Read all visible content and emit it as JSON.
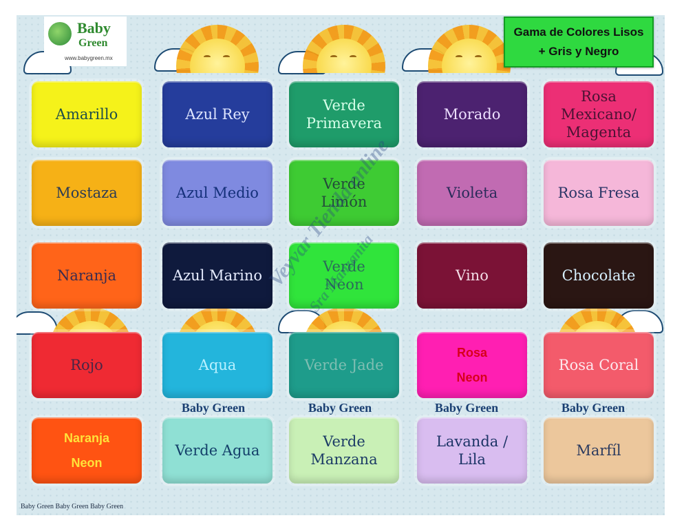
{
  "logo": {
    "word1": "Baby",
    "word2": "Green",
    "url": "www.babygreen.mx",
    "icon": "baby-green-logo-icon"
  },
  "title": {
    "line1": "Gama de Colores Lisos",
    "line2": "+ Gris y Negro"
  },
  "swatches": [
    {
      "lines": [
        "Amarillo"
      ],
      "bg": "#f5f21a",
      "fg": "#1e4d4a"
    },
    {
      "lines": [
        "Azul Rey"
      ],
      "bg": "#253d9c",
      "fg": "#dfe6ff"
    },
    {
      "lines": [
        "Verde",
        "Primavera"
      ],
      "bg": "#1f9c6a",
      "fg": "#d6ffe9"
    },
    {
      "lines": [
        "Morado"
      ],
      "bg": "#4c2270",
      "fg": "#ece0ff"
    },
    {
      "lines": [
        "Rosa",
        "Mexicano/",
        "Magenta"
      ],
      "bg": "#ec2f75",
      "fg": "#4a1233"
    },
    {
      "lines": [
        "Mostaza"
      ],
      "bg": "#f6b116",
      "fg": "#2b3b55"
    },
    {
      "lines": [
        "Azul Medio"
      ],
      "bg": "#7f8ae0",
      "fg": "#14307a"
    },
    {
      "lines": [
        "Verde",
        "Limón"
      ],
      "bg": "#3ecb33",
      "fg": "#234a3a"
    },
    {
      "lines": [
        "Violeta"
      ],
      "bg": "#c16bb2",
      "fg": "#2b2b5a"
    },
    {
      "lines": [
        "Rosa Fresa"
      ],
      "bg": "#f5b7d9",
      "fg": "#2b3566"
    },
    {
      "lines": [
        "Naranja"
      ],
      "bg": "#ff6419",
      "fg": "#3a2c4f"
    },
    {
      "lines": [
        "Azul Marino"
      ],
      "bg": "#0f1a3d",
      "fg": "#e6ecff"
    },
    {
      "lines": [
        "Verde",
        "Neon"
      ],
      "bg": "#30e43b",
      "fg": "#2b6a5a"
    },
    {
      "lines": [
        "Vino"
      ],
      "bg": "#7b1236",
      "fg": "#f3dce6"
    },
    {
      "lines": [
        "Chocolate"
      ],
      "bg": "#2a1613",
      "fg": "#d7f0ff"
    },
    {
      "lines": [
        "Rojo"
      ],
      "bg": "#ef2a33",
      "fg": "#4a2545"
    },
    {
      "lines": [
        "Aqua"
      ],
      "bg": "#23b5dc",
      "fg": "#b9f1ff"
    },
    {
      "lines": [
        "Verde Jade"
      ],
      "bg": "#1e9c8b",
      "fg": "#7fbeb2"
    },
    {
      "lines": [
        "Rosa",
        "Neon"
      ],
      "bg": "#ff1fb2",
      "fg": "#d7001c",
      "sans": true
    },
    {
      "lines": [
        "Rosa Coral"
      ],
      "bg": "#f35b6b",
      "fg": "#fde8ee"
    },
    {
      "lines": [
        "Naranja",
        "Neon"
      ],
      "bg": "#ff5312",
      "fg": "#ffe23a",
      "sans": true
    },
    {
      "lines": [
        "Verde Agua"
      ],
      "bg": "#8fe0d4",
      "fg": "#14406a"
    },
    {
      "lines": [
        "Verde",
        "Manzana"
      ],
      "bg": "#c9f0b6",
      "fg": "#1c3b66"
    },
    {
      "lines": [
        "Lavanda /",
        "Lila"
      ],
      "bg": "#d9bdf0",
      "fg": "#1c3466"
    },
    {
      "lines": [
        "Marfíl"
      ],
      "bg": "#ecc79c",
      "fg": "#2c3b5f"
    }
  ],
  "brand_labels": [
    "Baby Green",
    "Baby Green",
    "Baby Green",
    "Baby Green"
  ],
  "watermark": {
    "line1": "Veyvar Tienda online",
    "line2": "Sra Manzanita"
  },
  "footer": "Baby Green Baby Green Baby Green"
}
